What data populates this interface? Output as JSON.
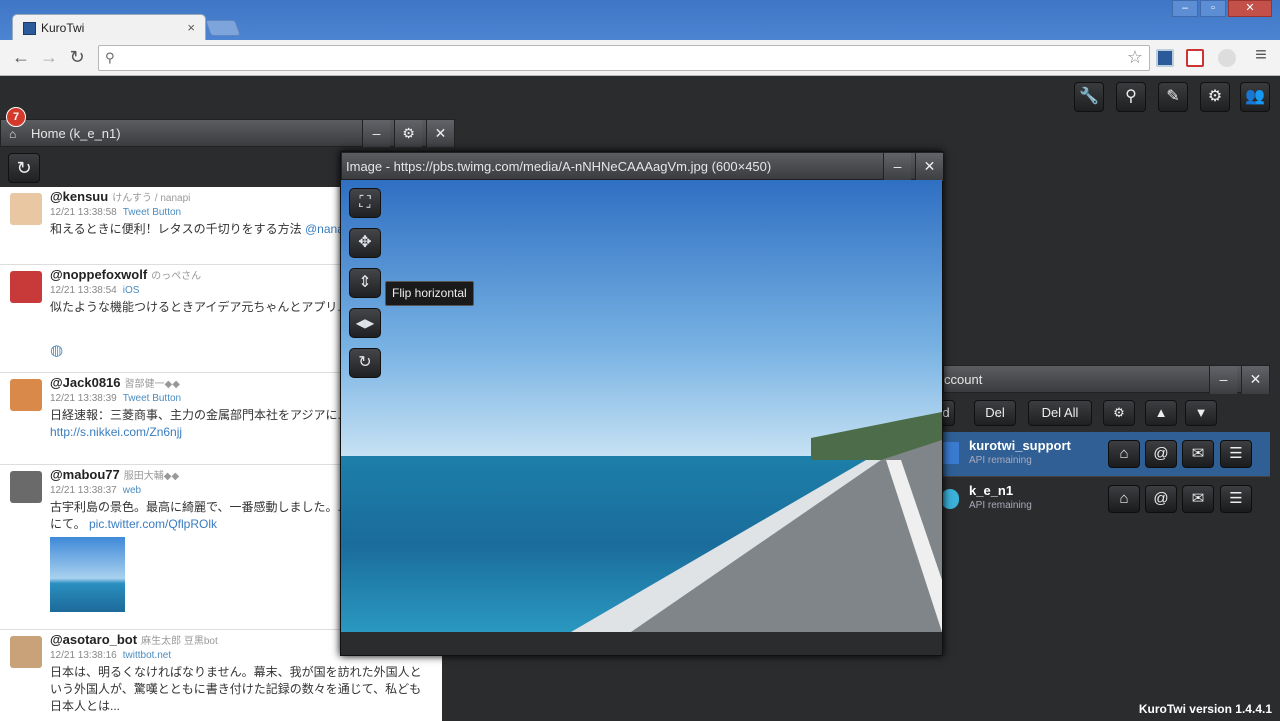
{
  "browser": {
    "tab_title": "KuroTwi",
    "tab_close": "×",
    "window_buttons": [
      "–",
      "▫",
      "✕"
    ],
    "nav": {
      "back": "←",
      "forward": "→",
      "reload": "↻"
    },
    "omnibox": {
      "value": "",
      "search_glyph": "⚲",
      "star": "☆"
    },
    "menu": "≡"
  },
  "app": {
    "toolbar_icons": [
      "wrench-icon",
      "search-icon",
      "compose-icon",
      "gear-icon",
      "users-icon"
    ],
    "toolbar_glyphs": [
      "🔧",
      "⚲",
      "✎",
      "⚙",
      "👥"
    ],
    "version": "KuroTwi version 1.4.4.1"
  },
  "home": {
    "title": "Home (k_e_n1)",
    "unread": "7",
    "buttons": {
      "minimize": "–",
      "settings": "⚙",
      "close": "✕"
    },
    "refresh": "↻",
    "tweets": [
      {
        "user": "@kensuu",
        "nick": "けんすう / nanapi",
        "time": "12/21 13:38:58",
        "source": "Tweet Button",
        "text": "和えるときに便利！レタスの千切りをする方法 ",
        "link": "@nanapi.jp/63443/",
        "avatar_color": "#e8c7a2"
      },
      {
        "user": "@noppefoxwolf",
        "nick": "のっぺさん",
        "time": "12/21 13:38:54",
        "source": "iOS",
        "text": "似たような機能つけるときアイデア元ちゃんとアプリ...てる。",
        "link": "",
        "avatar_color": "#c83a3a"
      },
      {
        "user": "@Jack0816",
        "nick": "習部健一◆◆",
        "time": "12/21 13:38:39",
        "source": "Tweet Button",
        "text": "日経速報：三菱商事、主力の金属部門本社をアジアに...経済新聞 ",
        "link": "http://s.nikkei.com/Zn6njj",
        "avatar_color": "#d98a4a"
      },
      {
        "user": "@mabou77",
        "nick": "服田大輔◆◆",
        "time": "12/21 13:38:37",
        "source": "web",
        "text": "古宇利島の景色。最高に綺麗で、一番感動しました。...メ。沖縄旅行にて。 ",
        "link": "pic.twitter.com/QflpROlk",
        "avatar_color": "#6a6a6a"
      },
      {
        "user": "@asotaro_bot",
        "nick": "麻生太郎 豆黒bot",
        "time": "12/21 13:38:16",
        "source": "twittbot.net",
        "text": "日本は、明るくなければなりません。幕末、我が国を訪れた外国人という外国人が、驚嘆とともに書き付けた記録の数々を通じて、私ども日本人とは...",
        "link": "",
        "avatar_color": "#caa27a"
      }
    ]
  },
  "image_window": {
    "title": "Image - https://pbs.twimg.com/media/A-nNHNeCAAAagVm.jpg (600×450)",
    "buttons": {
      "minimize": "–",
      "close": "✕"
    },
    "tools": [
      "⛶",
      "✥",
      "⇕",
      "◀▶",
      "↻"
    ],
    "tooltip": "Flip horizontal"
  },
  "account_window": {
    "title": "ccount",
    "buttons": {
      "minimize": "–",
      "close": "✕"
    },
    "actions": [
      "d",
      "Del",
      "Del All",
      "⚙",
      "▲",
      "▼"
    ],
    "accounts": [
      {
        "name": "kurotwi_support",
        "sub": "API remaining",
        "selected": true
      },
      {
        "name": "k_e_n1",
        "sub": "API remaining",
        "selected": false
      }
    ],
    "row_buttons": [
      "⌂",
      "@",
      "✉",
      "☰"
    ]
  },
  "colors": {
    "accent": "#4b7fc7",
    "selected_row": "#2f5f95",
    "badge": "#d43a2c"
  }
}
